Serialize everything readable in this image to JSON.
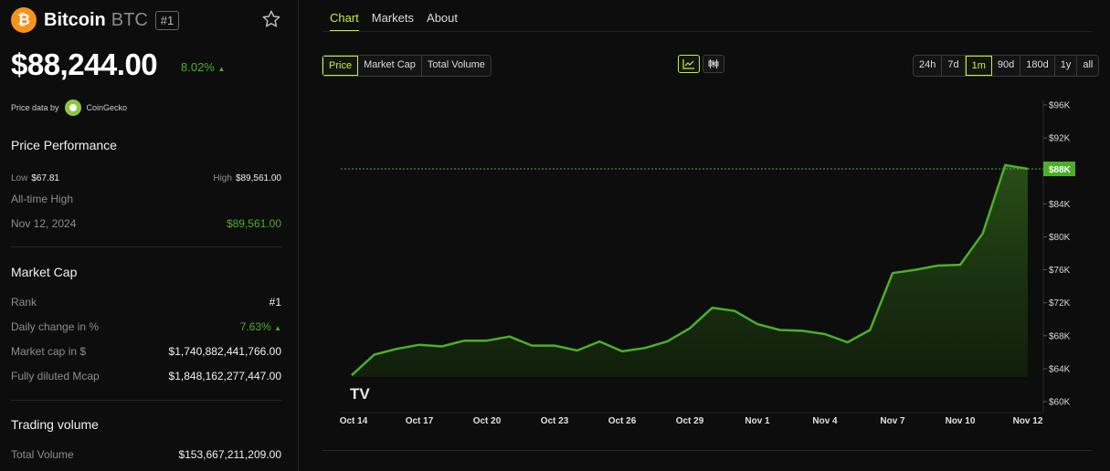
{
  "coin": {
    "logo_symbol": "₿",
    "name": "Bitcoin",
    "symbol": "BTC",
    "rank_badge": "#1",
    "price": "$88,244.00",
    "change_pct": "8.02%",
    "change_arrow": "▲",
    "price_data_by": "Price data by",
    "provider": "CoinGecko"
  },
  "performance": {
    "title": "Price Performance",
    "low_label": "Low",
    "low_value": "$67.81",
    "high_label": "High",
    "high_value": "$89,561.00",
    "ath_label": "All-time High",
    "ath_date": "Nov 12, 2024",
    "ath_value": "$89,561.00"
  },
  "market_cap": {
    "title": "Market Cap",
    "rows": [
      {
        "label": "Rank",
        "value": "#1"
      },
      {
        "label": "Daily change in %",
        "value": "7.63%",
        "arrow": "▲"
      },
      {
        "label": "Market cap in $",
        "value": "$1,740,882,441,766.00"
      },
      {
        "label": "Fully diluted Mcap",
        "value": "$1,848,162,277,447.00"
      }
    ]
  },
  "trading_volume": {
    "title": "Trading volume",
    "total_label": "Total Volume",
    "total_value": "$153,667,211,209.00"
  },
  "tabs": [
    "Chart",
    "Markets",
    "About"
  ],
  "metric_buttons": [
    "Price",
    "Market Cap",
    "Total Volume"
  ],
  "metric_active": "Price",
  "chart_type_icons": [
    "line-chart-icon",
    "candlestick-icon"
  ],
  "range_buttons": [
    "24h",
    "7d",
    "1m",
    "90d",
    "180d",
    "1y",
    "all"
  ],
  "range_active": "1m",
  "colors": {
    "accent": "#c6f135",
    "line": "#4caf28",
    "price_tag": "#4caf28",
    "bitcoin_orange": "#f7931a"
  },
  "chart_data": {
    "type": "area",
    "x_labels": [
      "Oct 14",
      "Oct 17",
      "Oct 20",
      "Oct 23",
      "Oct 26",
      "Oct 29",
      "Nov 1",
      "Nov 4",
      "Nov 7",
      "Nov 10",
      "Nov 12"
    ],
    "y_ticks": [
      "$60K",
      "$64K",
      "$68K",
      "$72K",
      "$76K",
      "$80K",
      "$84K",
      "$88K",
      "$92K",
      "$96K"
    ],
    "ylim": [
      60000,
      96000
    ],
    "current_price_label": "$88K",
    "current_price": 88244,
    "watermark": "TV",
    "points": [
      {
        "day": 0,
        "y": 63200
      },
      {
        "day": 1,
        "y": 65700
      },
      {
        "day": 2,
        "y": 66400
      },
      {
        "day": 3,
        "y": 66900
      },
      {
        "day": 4,
        "y": 66700
      },
      {
        "day": 5,
        "y": 67400
      },
      {
        "day": 6,
        "y": 67400
      },
      {
        "day": 7,
        "y": 67900
      },
      {
        "day": 8,
        "y": 66800
      },
      {
        "day": 9,
        "y": 66800
      },
      {
        "day": 10,
        "y": 66200
      },
      {
        "day": 11,
        "y": 67300
      },
      {
        "day": 12,
        "y": 66100
      },
      {
        "day": 13,
        "y": 66500
      },
      {
        "day": 14,
        "y": 67300
      },
      {
        "day": 15,
        "y": 68900
      },
      {
        "day": 16,
        "y": 71400
      },
      {
        "day": 17,
        "y": 71000
      },
      {
        "day": 18,
        "y": 69400
      },
      {
        "day": 19,
        "y": 68700
      },
      {
        "day": 20,
        "y": 68600
      },
      {
        "day": 21,
        "y": 68200
      },
      {
        "day": 22,
        "y": 67200
      },
      {
        "day": 23,
        "y": 68700
      },
      {
        "day": 24,
        "y": 75600
      },
      {
        "day": 25,
        "y": 76000
      },
      {
        "day": 26,
        "y": 76500
      },
      {
        "day": 27,
        "y": 76600
      },
      {
        "day": 28,
        "y": 80400
      },
      {
        "day": 29,
        "y": 88700
      },
      {
        "day": 30,
        "y": 88244
      }
    ]
  }
}
